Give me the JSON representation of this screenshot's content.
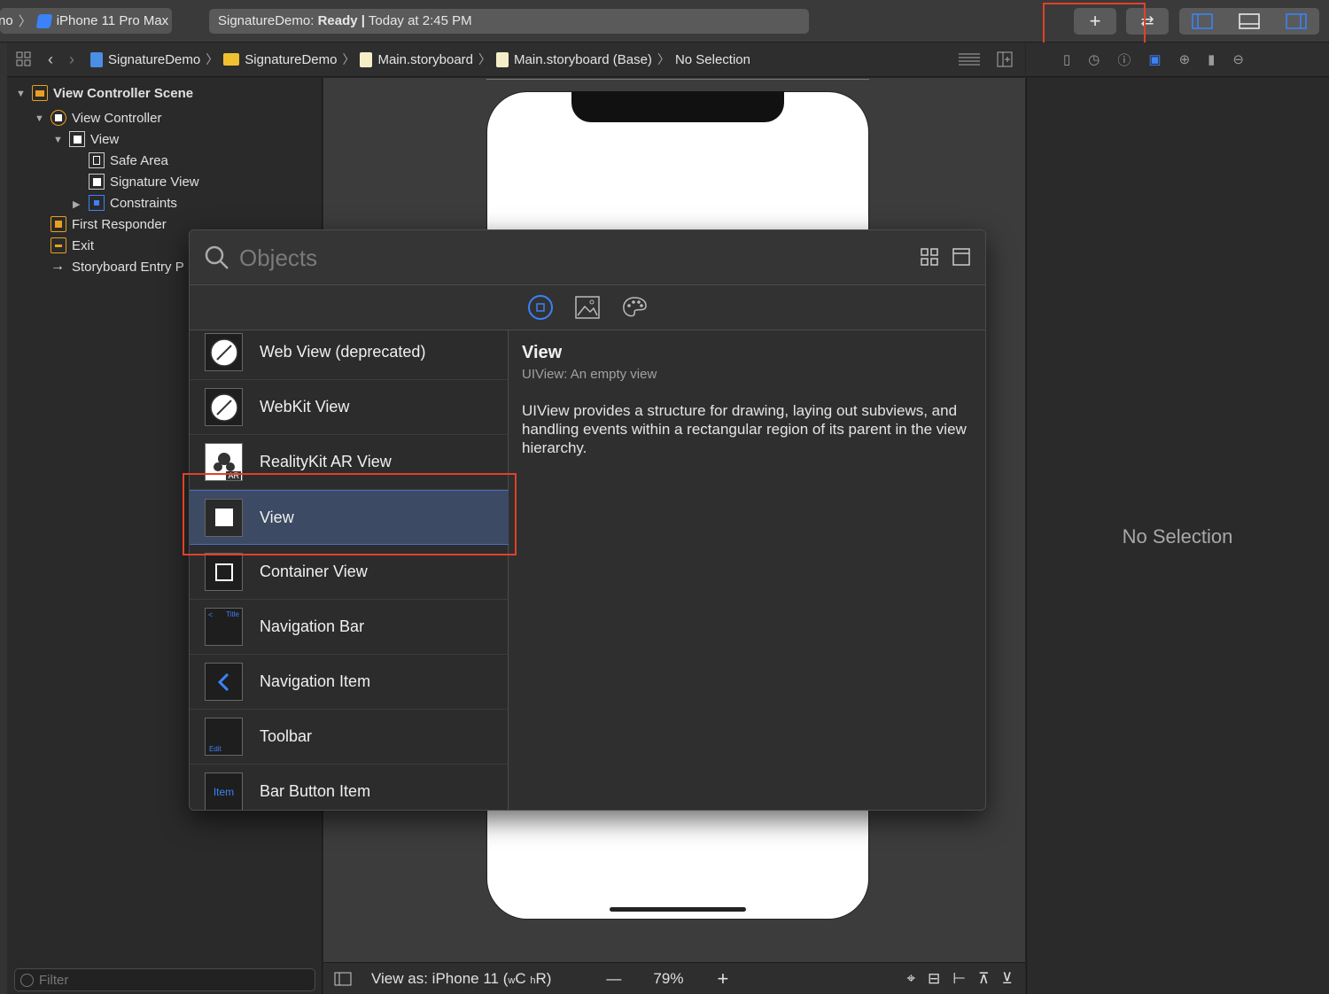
{
  "toolbar": {
    "scheme_cut": "no",
    "device": "iPhone 11 Pro Max",
    "status_app": "SignatureDemo:",
    "status_state": "Ready",
    "status_sep": "|",
    "status_time": "Today at 2:45 PM",
    "library_button": "+",
    "review_button": "⇄"
  },
  "jumpbar": {
    "crumbs": [
      "SignatureDemo",
      "SignatureDemo",
      "Main.storyboard",
      "Main.storyboard (Base)",
      "No Selection"
    ]
  },
  "outline": {
    "items": [
      {
        "label": "View Controller Scene"
      },
      {
        "label": "View Controller"
      },
      {
        "label": "View"
      },
      {
        "label": "Safe Area"
      },
      {
        "label": "Signature View"
      },
      {
        "label": "Constraints"
      },
      {
        "label": "First Responder"
      },
      {
        "label": "Exit"
      },
      {
        "label": "Storyboard Entry P"
      }
    ],
    "filter_placeholder": "Filter"
  },
  "library": {
    "search_placeholder": "Objects",
    "items": [
      {
        "label": "Web View (deprecated)",
        "icon": "compass-icon"
      },
      {
        "label": "WebKit View",
        "icon": "compass-icon"
      },
      {
        "label": "RealityKit AR View",
        "icon": "ar-icon"
      },
      {
        "label": "View",
        "icon": "view-icon"
      },
      {
        "label": "Container View",
        "icon": "container-icon"
      },
      {
        "label": "Navigation Bar",
        "icon": "navbar-icon"
      },
      {
        "label": "Navigation Item",
        "icon": "chevron-left-icon"
      },
      {
        "label": "Toolbar",
        "icon": "toolbar-icon"
      },
      {
        "label": "Bar Button Item",
        "icon": "bar-button-icon"
      }
    ],
    "icon_texts": {
      "navbar_back": "<",
      "navbar_title": "Title",
      "toolbar_edit": "Edit",
      "bar_item": "Item",
      "ar": "AR"
    },
    "detail": {
      "title": "View",
      "subtitle": "UIView: An empty view",
      "description": "UIView provides a structure for drawing, laying out subviews, and handling events within a rectangular region of its parent in the view hierarchy."
    }
  },
  "inspector": {
    "empty_label": "No Selection"
  },
  "canvas_bar": {
    "view_as": "View as: iPhone 11 (",
    "size_w": "w",
    "size_c": "C",
    "size_h": "h",
    "size_r": "R)",
    "zoom_minus": "—",
    "zoom": "79%",
    "zoom_plus": "+"
  },
  "colors": {
    "accent": "#3b82f6",
    "highlight": "#e0412a",
    "selection": "#3d4a63"
  }
}
